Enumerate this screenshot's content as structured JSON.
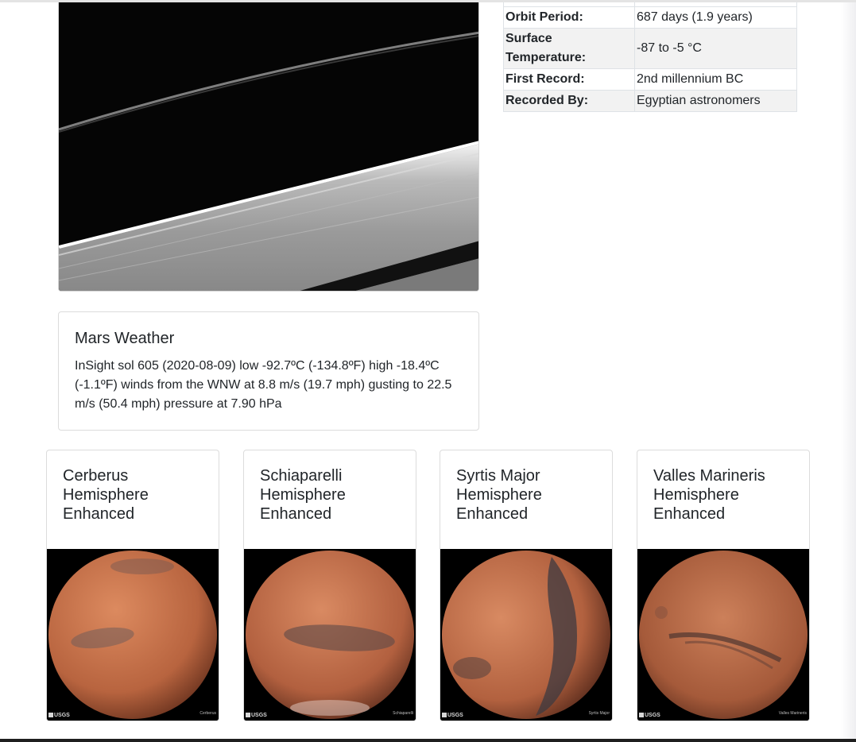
{
  "featured_image": {
    "alt": "Saturn rings featured space image"
  },
  "facts": [
    {
      "label": "Orbit Period:",
      "value": "687 days (1.9 years)"
    },
    {
      "label": "Surface Temperature:",
      "value": "-87 to -5 °C"
    },
    {
      "label": "First Record:",
      "value": "2nd millennium BC"
    },
    {
      "label": "Recorded By:",
      "value": "Egyptian astronomers"
    }
  ],
  "weather": {
    "title": "Mars Weather",
    "text": "InSight sol 605 (2020-08-09) low -92.7ºC (-134.8ºF) high -18.4ºC (-1.1ºF) winds from the WNW at 8.8 m/s (19.7 mph) gusting to 22.5 m/s (50.4 mph) pressure at 7.90 hPa"
  },
  "hemispheres": [
    {
      "title": "Cerberus Hemisphere Enhanced",
      "logo": "USGS",
      "caption": "Cerberus"
    },
    {
      "title": "Schiaparelli Hemisphere Enhanced",
      "logo": "USGS",
      "caption": "Schiaparelli"
    },
    {
      "title": "Syrtis Major Hemisphere Enhanced",
      "logo": "USGS",
      "caption": "Syrtis Major"
    },
    {
      "title": "Valles Marineris Hemisphere Enhanced",
      "logo": "USGS",
      "caption": "Valles Marineris"
    }
  ],
  "colors": {
    "mars_base": "#c8704a",
    "mars_dark": "#5e4a48",
    "table_stripe": "#f2f2f2",
    "border": "#dee2e6"
  }
}
